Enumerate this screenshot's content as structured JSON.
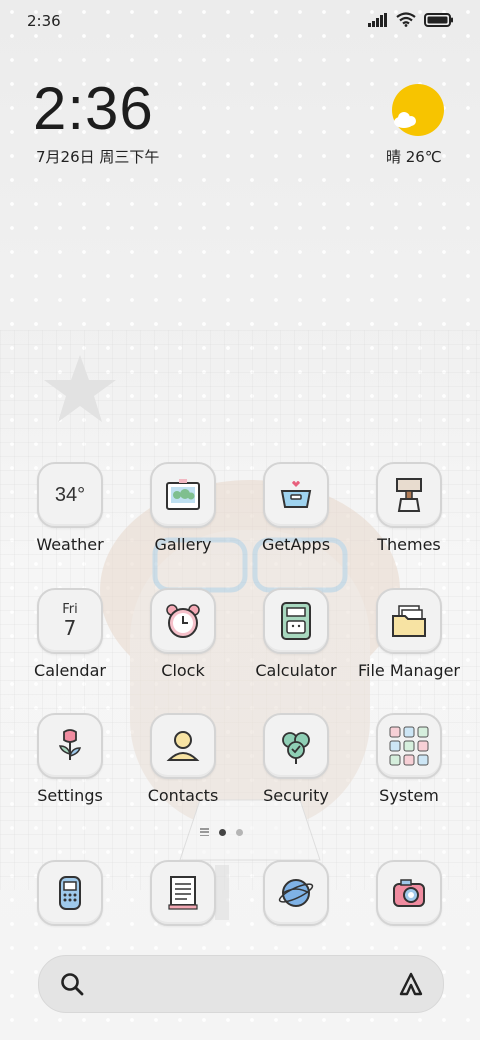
{
  "status_bar": {
    "time": "2:36"
  },
  "widget": {
    "clock_time": "2:36",
    "date": "7月26日 周三下午",
    "weather": "晴 26℃"
  },
  "apps": [
    {
      "label": "Weather",
      "tile_text": "34°",
      "icon": "weather-icon"
    },
    {
      "label": "Gallery",
      "icon": "gallery-icon"
    },
    {
      "label": "GetApps",
      "icon": "getapps-icon"
    },
    {
      "label": "Themes",
      "icon": "themes-icon"
    },
    {
      "label": "Calendar",
      "tile_day": "Fri",
      "tile_date": "7",
      "icon": "calendar-icon"
    },
    {
      "label": "Clock",
      "icon": "clock-icon"
    },
    {
      "label": "Calculator",
      "icon": "calculator-icon"
    },
    {
      "label": "File Manager",
      "icon": "file-manager-icon"
    },
    {
      "label": "Settings",
      "icon": "settings-icon"
    },
    {
      "label": "Contacts",
      "icon": "contacts-icon"
    },
    {
      "label": "Security",
      "icon": "security-icon"
    },
    {
      "label": "System",
      "icon": "system-folder-icon"
    }
  ],
  "dock": [
    {
      "icon": "phone-icon"
    },
    {
      "icon": "notes-icon"
    },
    {
      "icon": "browser-icon"
    },
    {
      "icon": "camera-icon"
    }
  ],
  "search": {
    "placeholder": ""
  },
  "colors": {
    "sun": "#f7c400",
    "tile_border": "#d4d4d4",
    "tile_bg": "#f2f2f2"
  }
}
